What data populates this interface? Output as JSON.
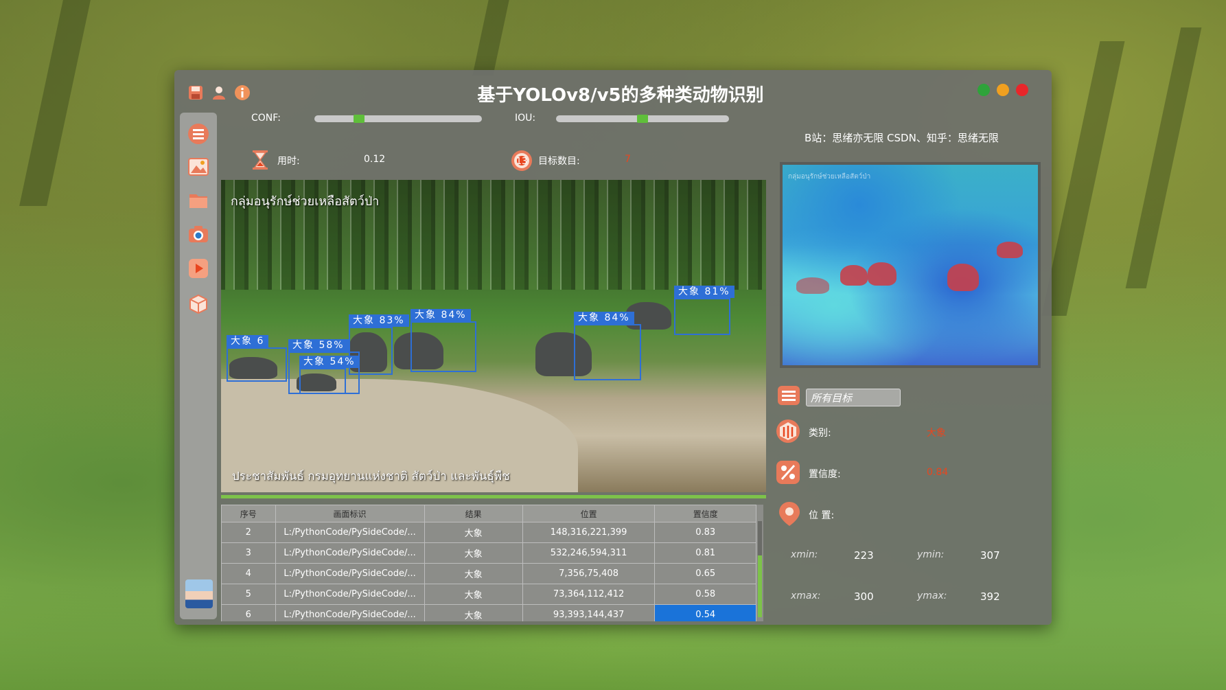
{
  "window": {
    "title": "基于YOLOv8/v5的多种类动物识别",
    "credit": "B站：思绪亦无限  CSDN、知乎：思绪无限"
  },
  "controls": {
    "conf_label": "CONF:",
    "conf_value": 0.25,
    "iou_label": "IOU:",
    "iou_value": 0.5,
    "time_label": "用时:",
    "time_value": "0.12",
    "count_label": "目标数目:",
    "count_value": "7"
  },
  "video": {
    "top_caption": "กลุ่มอนุรักษ์ช่วยเหลือสัตว์ป่า",
    "bottom_caption": "ประชาสัมพันธ์ กรมอุทยานแห่งชาติ สัตว์ป่า และพันธุ์พืช",
    "detections": [
      {
        "label": "大象 83%"
      },
      {
        "label": "大象 84%"
      },
      {
        "label": "大象 84%"
      },
      {
        "label": "大象 81%"
      },
      {
        "label": "大象 58%"
      },
      {
        "label": "大象 54%"
      },
      {
        "label": "大象 6"
      }
    ]
  },
  "table": {
    "headers": [
      "序号",
      "画面标识",
      "结果",
      "位置",
      "置信度"
    ],
    "rows": [
      [
        "2",
        "L:/PythonCode/PySideCode/...",
        "大象",
        "148,316,221,399",
        "0.83"
      ],
      [
        "3",
        "L:/PythonCode/PySideCode/...",
        "大象",
        "532,246,594,311",
        "0.81"
      ],
      [
        "4",
        "L:/PythonCode/PySideCode/...",
        "大象",
        "7,356,75,408",
        "0.65"
      ],
      [
        "5",
        "L:/PythonCode/PySideCode/...",
        "大象",
        "73,364,112,412",
        "0.58"
      ],
      [
        "6",
        "L:/PythonCode/PySideCode/...",
        "大象",
        "93,393,144,437",
        "0.54"
      ]
    ]
  },
  "heatmap": {
    "caption": "กลุ่มอนุรักษ์ช่วยเหลือสัตว์ป่า"
  },
  "detail": {
    "target_select": "所有目标",
    "class_label": "类别:",
    "class_value": "大象",
    "conf_label": "置信度:",
    "conf_value": "0.84",
    "pos_label": "位 置:",
    "xmin_label": "xmin:",
    "xmin": "223",
    "ymin_label": "ymin:",
    "ymin": "307",
    "xmax_label": "xmax:",
    "xmax": "300",
    "ymax_label": "ymax:",
    "ymax": "392"
  },
  "colors": {
    "accent_green": "#7dc24a",
    "selection_blue": "#1a73d9",
    "highlight_red": "#e8461f",
    "dot_green": "#2ea33a",
    "dot_orange": "#f0a020",
    "dot_red": "#e8262a"
  },
  "icons": {
    "title_bar": [
      "save-icon",
      "user-icon",
      "info-icon"
    ],
    "sidebar": [
      "menu-icon",
      "image-icon",
      "folder-icon",
      "camera-icon",
      "play-icon",
      "model-icon"
    ]
  }
}
